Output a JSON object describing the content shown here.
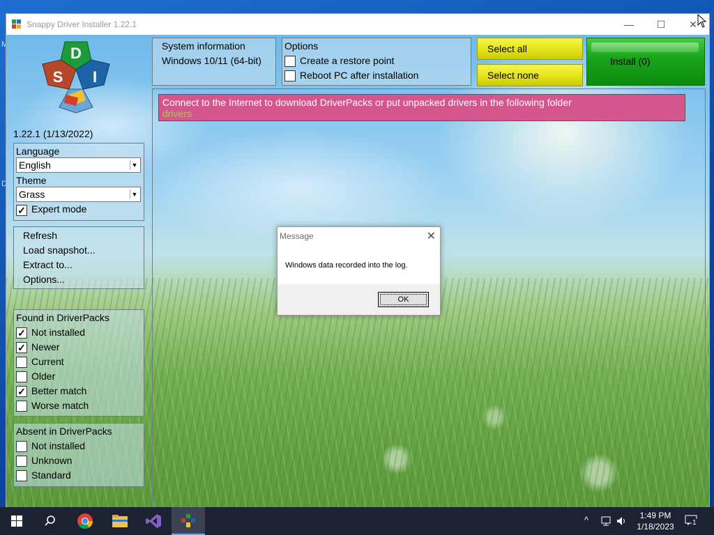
{
  "window": {
    "title": "Snappy Driver Installer 1.22.1",
    "minimize": "—",
    "maximize": "☐",
    "close": "✕"
  },
  "logo": {
    "letters": [
      "D",
      "S",
      "I"
    ],
    "version": "1.22.1 (1/13/2022)"
  },
  "settings": {
    "language_label": "Language",
    "language_value": "English",
    "theme_label": "Theme",
    "theme_value": "Grass",
    "expert_mode_label": "Expert mode",
    "expert_mode_checked": true
  },
  "menu": {
    "items": [
      "Refresh",
      "Load snapshot...",
      "Extract to...",
      "Options..."
    ]
  },
  "found_in_driverpacks": {
    "header": "Found in DriverPacks",
    "items": [
      {
        "label": "Not installed",
        "checked": true
      },
      {
        "label": "Newer",
        "checked": true
      },
      {
        "label": "Current",
        "checked": false
      },
      {
        "label": "Older",
        "checked": false
      },
      {
        "label": "Better match",
        "checked": true
      },
      {
        "label": "Worse match",
        "checked": false
      }
    ]
  },
  "absent_in_driverpacks": {
    "header": "Absent in DriverPacks",
    "items": [
      {
        "label": "Not installed",
        "checked": false
      },
      {
        "label": "Unknown",
        "checked": false
      },
      {
        "label": "Standard",
        "checked": false
      }
    ]
  },
  "system_info": {
    "header": "System information",
    "os": "Windows 10/11 (64-bit)"
  },
  "options": {
    "header": "Options",
    "items": [
      {
        "label": "Create a restore point",
        "checked": false
      },
      {
        "label": "Reboot PC after installation",
        "checked": false
      }
    ]
  },
  "buttons": {
    "select_all": "Select all",
    "select_none": "Select none",
    "install": "Install (0)"
  },
  "banner": {
    "message": "Connect to the Internet to download DriverPacks or put unpacked drivers in the following folder",
    "folder": "drivers"
  },
  "dialog": {
    "title": "Message",
    "message": "Windows data recorded into the log.",
    "ok": "OK",
    "close": "✕"
  },
  "taskbar": {
    "time": "1:49 PM",
    "date": "1/18/2023",
    "notification_count": "1"
  },
  "colors": {
    "banner_bg": "#d3568c",
    "folder_text": "#a6cf44",
    "select_button": "#e6e61a",
    "install_button": "#1aa61a"
  }
}
